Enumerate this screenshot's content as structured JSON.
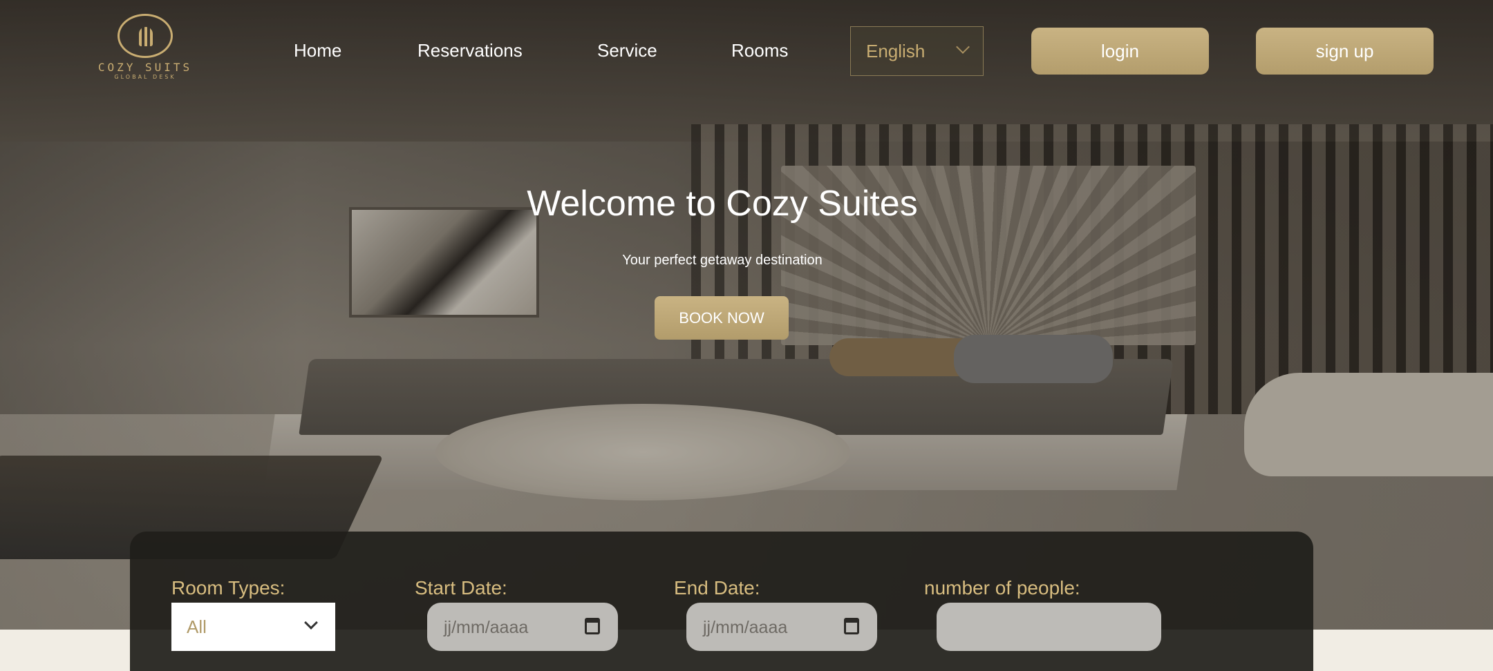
{
  "brand": {
    "name": "COZY SUITS",
    "tagline": "GLOBAL DESK"
  },
  "nav": {
    "home": "Home",
    "reservations": "Reservations",
    "service": "Service",
    "rooms": "Rooms"
  },
  "language": {
    "selected": "English"
  },
  "auth": {
    "login": "login",
    "signup": "sign up"
  },
  "hero": {
    "title": "Welcome to Cozy Suites",
    "subtitle": "Your perfect getaway destination",
    "cta": "BOOK NOW"
  },
  "booking": {
    "room_types_label": "Room Types:",
    "room_types_value": "All",
    "start_date_label": "Start Date:",
    "start_date_placeholder": "jj/mm/aaaa",
    "end_date_label": "End Date:",
    "end_date_placeholder": "jj/mm/aaaa",
    "people_label": "number of people:",
    "people_value": ""
  },
  "colors": {
    "gold": "#c9ad72",
    "button_gold": "#c1aa79",
    "panel": "#201e1a",
    "input_bg": "#bdbbb7"
  },
  "icons": [
    "logo-emblem-icon",
    "chevron-down-icon",
    "calendar-icon"
  ]
}
